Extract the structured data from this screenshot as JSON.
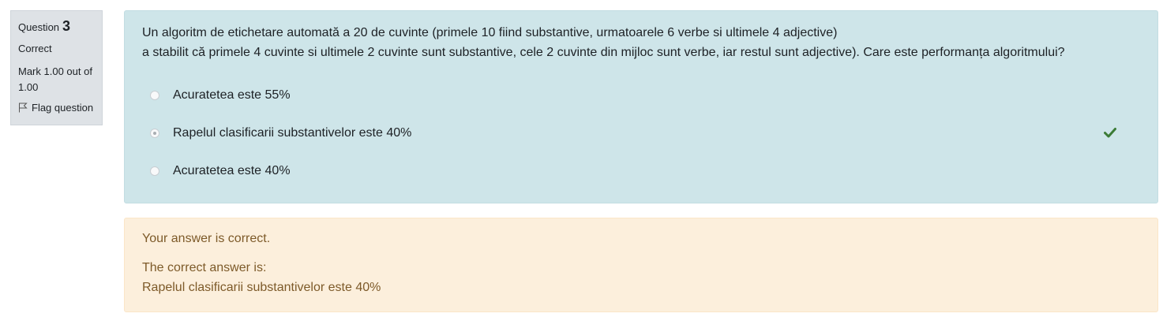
{
  "info": {
    "question_label": "Question",
    "question_number": "3",
    "state": "Correct",
    "grade": "Mark 1.00 out of 1.00",
    "flag_label": "Flag question"
  },
  "question": {
    "text_line1": "Un algoritm de etichetare automată a 20 de cuvinte (primele 10 fiind substantive, urmatoarele 6 verbe si ultimele 4 adjective)",
    "text_line2": "a stabilit că primele 4 cuvinte si ultimele 2 cuvinte sunt substantive, cele 2 cuvinte din mijloc sunt verbe, iar restul sunt adjective). Care este performanța algoritmului?",
    "answers": [
      {
        "label": "Acuratetea este 55%",
        "selected": false
      },
      {
        "label": "Rapelul clasificarii substantivelor este 40%",
        "selected": true
      },
      {
        "label": "Acuratetea este 40%",
        "selected": false
      }
    ],
    "correct_icon": "check-icon"
  },
  "outcome": {
    "feedback": "Your answer is correct.",
    "right_answer_heading": "The correct answer is:",
    "right_answer": "Rapelul clasificarii substantivelor este 40%"
  },
  "colors": {
    "formulation_bg": "#cee5e9",
    "outcome_bg": "#fcefdc",
    "outcome_text": "#7d5a29",
    "info_bg": "#dee2e6",
    "correct_green": "#3b7b36"
  }
}
